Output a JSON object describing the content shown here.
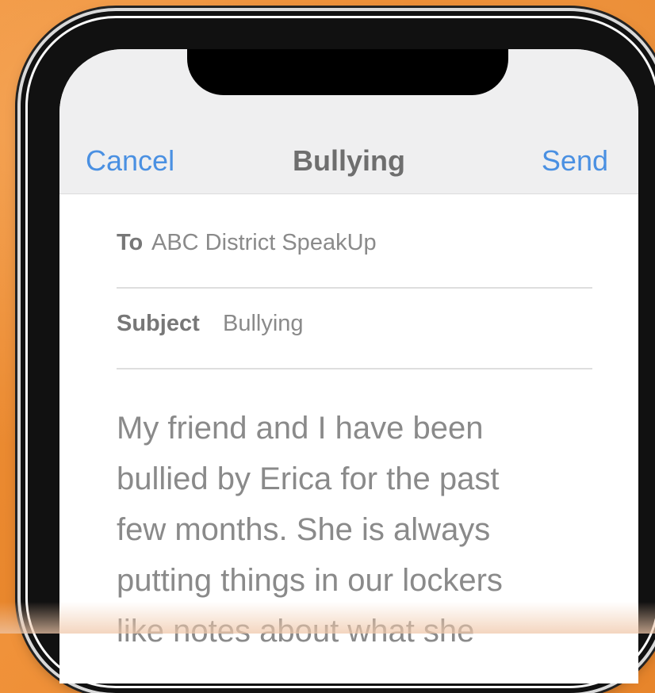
{
  "compose": {
    "cancel_label": "Cancel",
    "title": "Bullying",
    "send_label": "Send",
    "to_label": "To",
    "to_value": "ABC District SpeakUp",
    "subject_label": "Subject",
    "subject_value": "Bullying",
    "body": "My friend and I have been\nbullied by Erica for the past\nfew months. She is always\nputting things in our lockers\nlike notes about what she"
  }
}
